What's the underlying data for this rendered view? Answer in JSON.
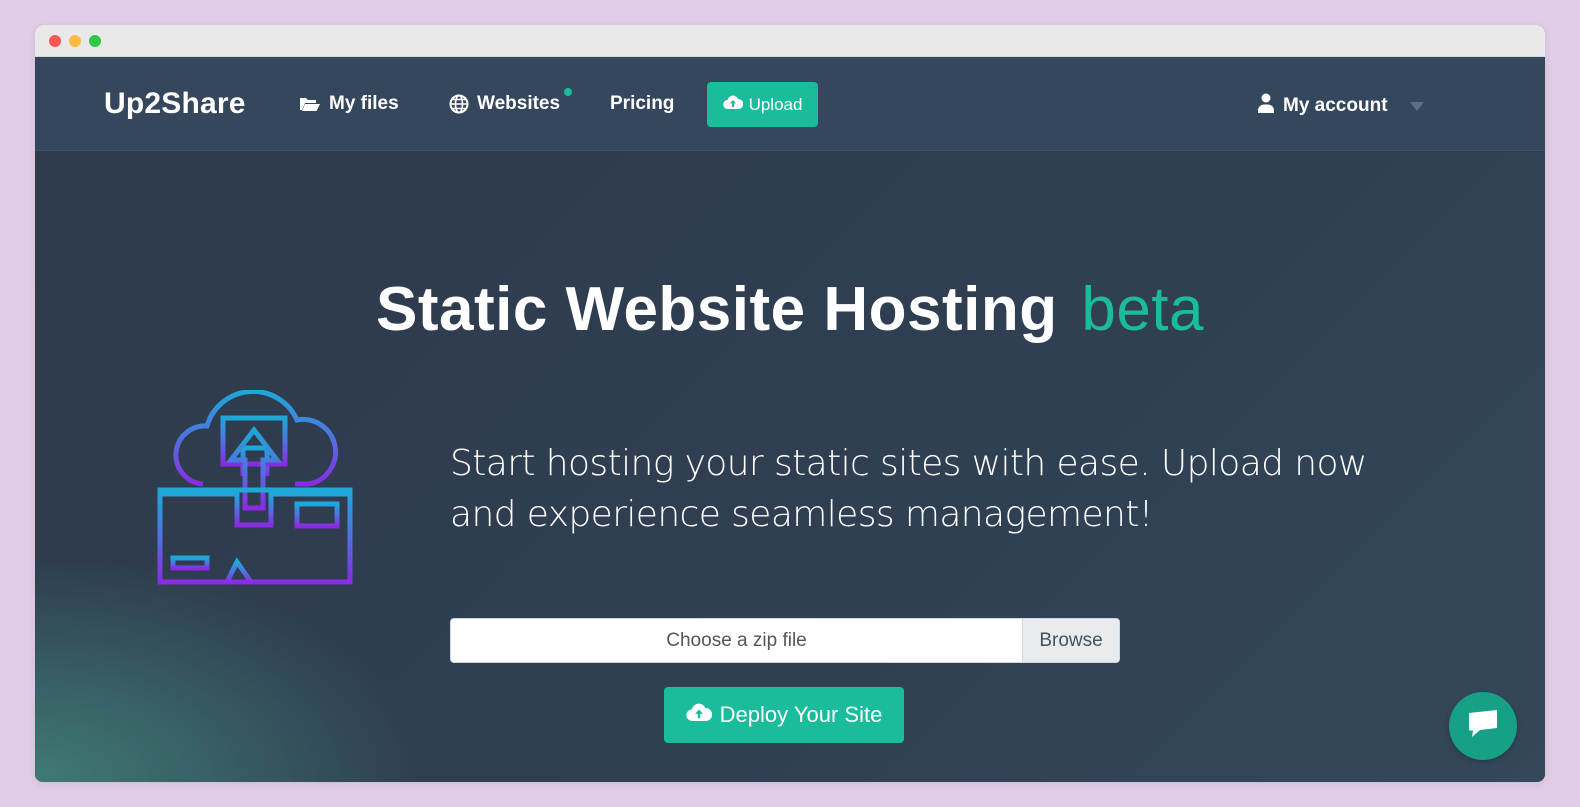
{
  "nav": {
    "brand": "Up2Share",
    "my_files": "My files",
    "websites": "Websites",
    "pricing": "Pricing",
    "upload": "Upload",
    "account": "My account"
  },
  "hero": {
    "title": "Static Website Hosting",
    "title_badge": "beta",
    "description": "Start hosting your static sites with ease. Upload now and experience seamless management!",
    "file_placeholder": "Choose a zip file",
    "browse_label": "Browse",
    "deploy_label": "Deploy Your Site"
  },
  "icons": {
    "my_files": "folder-open-icon",
    "websites": "globe-icon",
    "upload": "cloud-upload-icon",
    "account": "user-icon",
    "chat": "chat-icon",
    "illustration": "cloud-upload-illustration"
  },
  "colors": {
    "accent": "#1abc9c",
    "navbar": "#35475c",
    "hero_bg": "#2f3e4f",
    "background": "#e0cce4"
  }
}
